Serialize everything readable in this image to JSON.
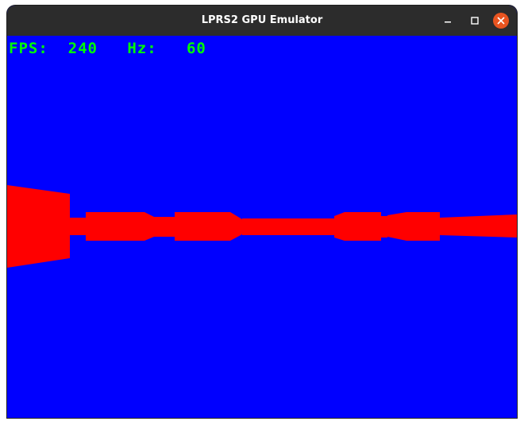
{
  "window": {
    "title": "LPRS2 GPU Emulator",
    "controls": {
      "minimize_icon": "minimize-icon",
      "maximize_icon": "maximize-icon",
      "close_icon": "close-icon",
      "close_color": "#e95420"
    }
  },
  "hud": {
    "fps_label": "FPS:",
    "fps_value": "240",
    "hz_label": "Hz:",
    "hz_value": "60",
    "color": "#00ff00"
  },
  "scene": {
    "background_color": "#0000ff",
    "shape_color": "#ff0000"
  }
}
